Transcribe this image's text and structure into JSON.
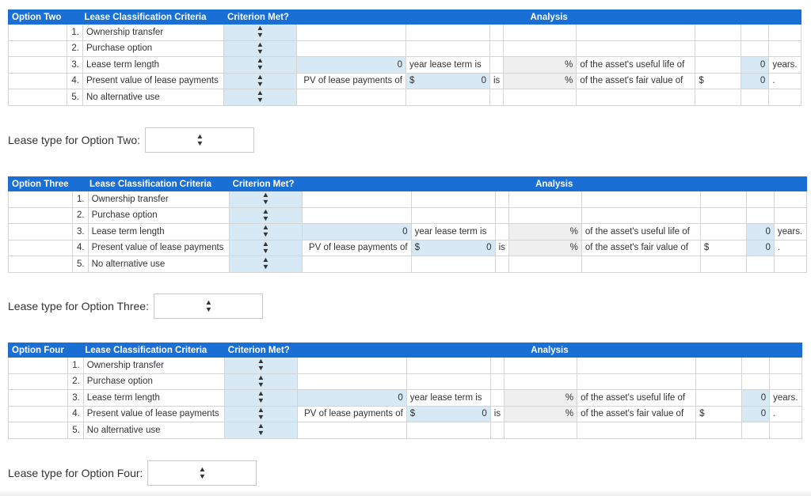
{
  "sections": [
    {
      "title": "Option Two",
      "header": {
        "criteria": "Lease Classification Criteria",
        "met": "Criterion Met?",
        "analysis": "Analysis"
      },
      "criteria": [
        {
          "num": "1.",
          "label": "Ownership transfer"
        },
        {
          "num": "2.",
          "label": "Purchase option"
        },
        {
          "num": "3.",
          "label": "Lease term length"
        },
        {
          "num": "4.",
          "label": "Present value of lease payments"
        },
        {
          "num": "5.",
          "label": "No alternative use"
        }
      ],
      "row3": {
        "value": "0",
        "text": "year lease term is",
        "pct": "%",
        "pct_text": "of the asset's useful life of",
        "life": "0",
        "unit": "years."
      },
      "row4": {
        "label": "PV of lease payments of",
        "dollar": "$",
        "value": "0",
        "is": "is",
        "pct": "%",
        "pct_text": "of the asset's fair value of",
        "dollar2": "$",
        "fv": "0",
        "dot": "."
      },
      "lease_type_label": "Lease type for Option Two:"
    },
    {
      "title": "Option Three",
      "header": {
        "criteria": "Lease Classification Criteria",
        "met": "Criterion Met?",
        "analysis": "Analysis"
      },
      "criteria": [
        {
          "num": "1.",
          "label": "Ownership transfer"
        },
        {
          "num": "2.",
          "label": "Purchase option"
        },
        {
          "num": "3.",
          "label": "Lease term length"
        },
        {
          "num": "4.",
          "label": "Present value of lease payments"
        },
        {
          "num": "5.",
          "label": "No alternative use"
        }
      ],
      "row3": {
        "value": "0",
        "text": "year lease term is",
        "pct": "%",
        "pct_text": "of the asset's useful life of",
        "life": "0",
        "unit": "years."
      },
      "row4": {
        "label": "PV of lease payments of",
        "dollar": "$",
        "value": "0",
        "is": "is",
        "pct": "%",
        "pct_text": "of the asset's fair value of",
        "dollar2": "$",
        "fv": "0",
        "dot": "."
      },
      "lease_type_label": "Lease type for Option Three:"
    },
    {
      "title": "Option Four",
      "header": {
        "criteria": "Lease Classification Criteria",
        "met": "Criterion Met?",
        "analysis": "Analysis"
      },
      "criteria": [
        {
          "num": "1.",
          "label": "Ownership transfer"
        },
        {
          "num": "2.",
          "label": "Purchase option"
        },
        {
          "num": "3.",
          "label": "Lease term length"
        },
        {
          "num": "4.",
          "label": "Present value of lease payments"
        },
        {
          "num": "5.",
          "label": "No alternative use"
        }
      ],
      "row3": {
        "value": "0",
        "text": "year lease term is",
        "pct": "%",
        "pct_text": "of the asset's useful life of",
        "life": "0",
        "unit": "years."
      },
      "row4": {
        "label": "PV of lease payments of",
        "dollar": "$",
        "value": "0",
        "is": "is",
        "pct": "%",
        "pct_text": "of the asset's fair value of",
        "dollar2": "$",
        "fv": "0",
        "dot": "."
      },
      "lease_type_label": "Lease type for Option Four:"
    }
  ],
  "icons": {
    "select": "up-down-arrows-icon"
  },
  "colors": {
    "header": "#1a6fd4",
    "input": "#d7e9f5",
    "readonly": "#efefef"
  }
}
